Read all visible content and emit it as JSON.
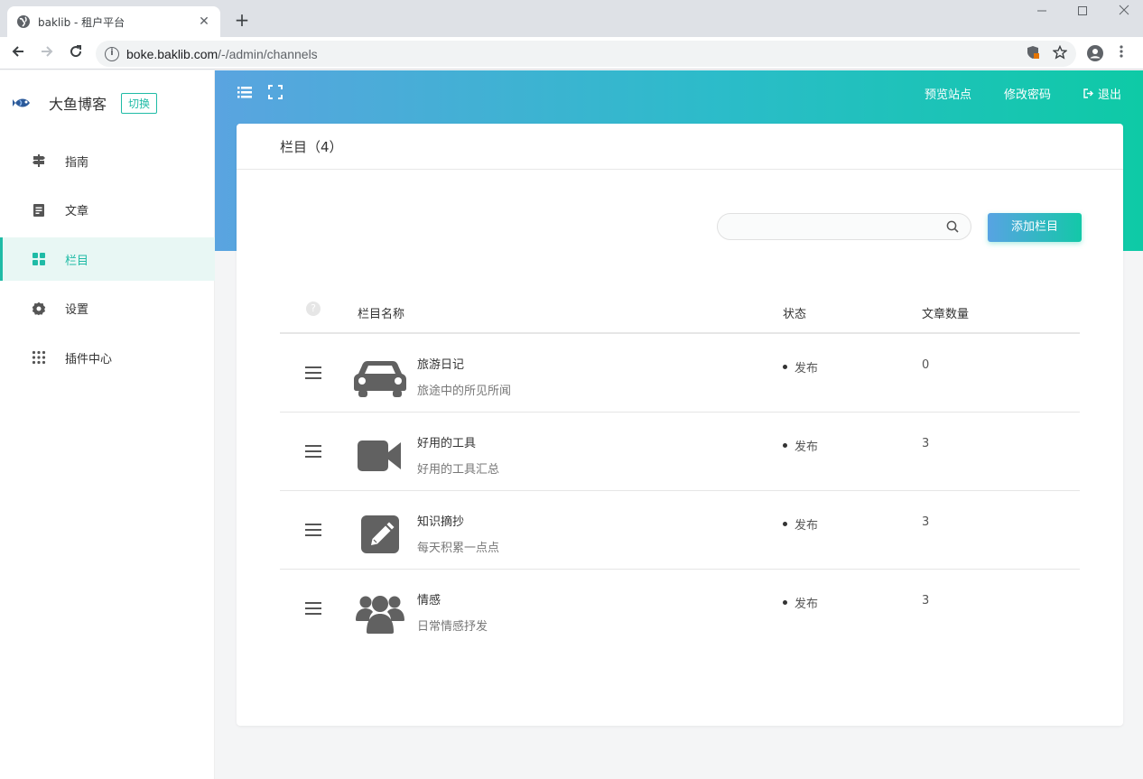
{
  "browser": {
    "tab_title": "baklib - 租户平台",
    "tab_close": "✕",
    "new_tab": "+",
    "url_host": "boke.baklib.com",
    "url_path": "/-/admin/channels"
  },
  "sidebar": {
    "site_name": "大鱼博客",
    "switch_label": "切换",
    "items": [
      {
        "label": "指南",
        "icon": "signpost-icon"
      },
      {
        "label": "文章",
        "icon": "document-icon"
      },
      {
        "label": "栏目",
        "icon": "grid-icon",
        "active": true
      },
      {
        "label": "设置",
        "icon": "gear-icon"
      },
      {
        "label": "插件中心",
        "icon": "dots-grid-icon"
      }
    ]
  },
  "topnav": {
    "preview": "预览站点",
    "change_password": "修改密码",
    "logout": "退出"
  },
  "main": {
    "title": "栏目（4）",
    "add_button": "添加栏目",
    "search": {
      "value": "",
      "placeholder": ""
    },
    "columns": {
      "help": "?",
      "name": "栏目名称",
      "status": "状态",
      "count": "文章数量"
    },
    "rows": [
      {
        "name": "旅游日记",
        "desc": "旅途中的所见所闻",
        "status": "发布",
        "count": "0",
        "icon": "car-icon"
      },
      {
        "name": "好用的工具",
        "desc": "好用的工具汇总",
        "status": "发布",
        "count": "3",
        "icon": "video-camera-icon"
      },
      {
        "name": "知识摘抄",
        "desc": "每天积累一点点",
        "status": "发布",
        "count": "3",
        "icon": "pencil-square-icon"
      },
      {
        "name": "情感",
        "desc": "日常情感抒发",
        "status": "发布",
        "count": "3",
        "icon": "users-icon"
      }
    ]
  },
  "colors": {
    "accent": "#1fbba6",
    "gradient_start": "#5aa4e0",
    "gradient_end": "#0ecaa6"
  }
}
